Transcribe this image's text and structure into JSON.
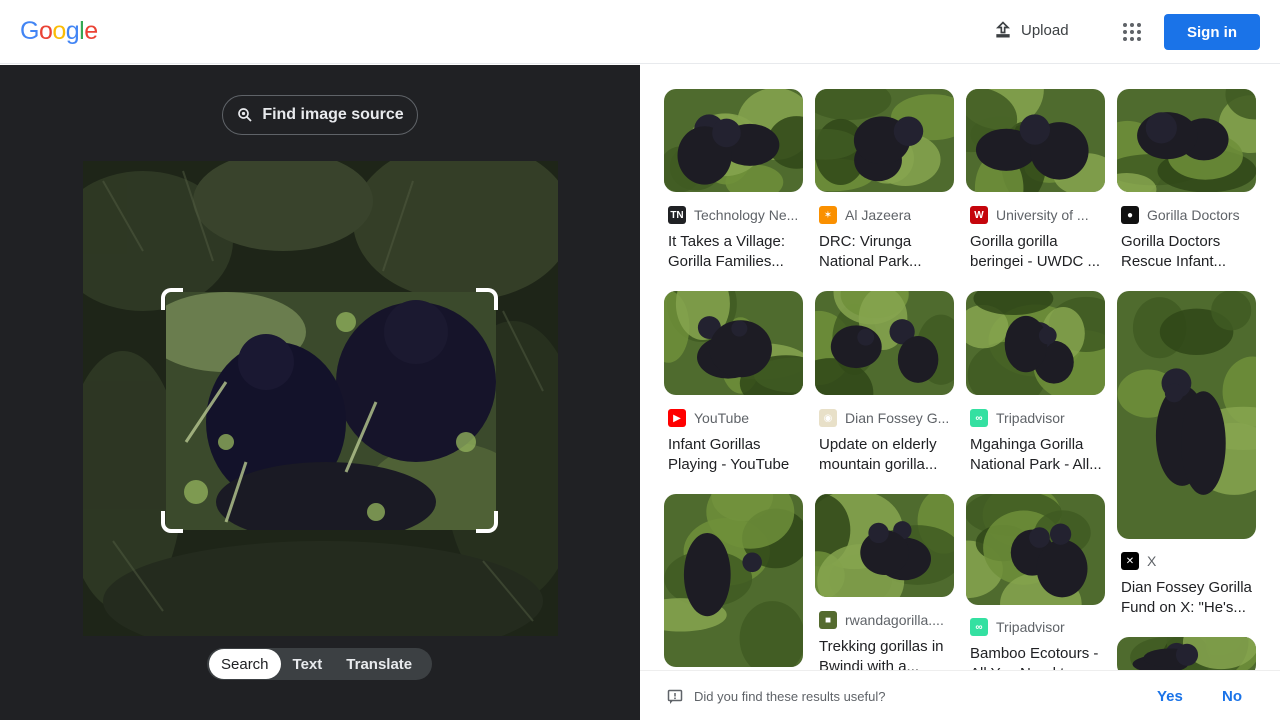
{
  "header": {
    "logo_letters": [
      {
        "ch": "G",
        "color": "#4285F4"
      },
      {
        "ch": "o",
        "color": "#EA4335"
      },
      {
        "ch": "o",
        "color": "#FBBC05"
      },
      {
        "ch": "g",
        "color": "#4285F4"
      },
      {
        "ch": "l",
        "color": "#34A853"
      },
      {
        "ch": "e",
        "color": "#EA4335"
      }
    ],
    "upload_label": "Upload",
    "signin_label": "Sign in"
  },
  "lens": {
    "find_source_label": "Find image source",
    "modes": [
      "Search",
      "Text",
      "Translate"
    ],
    "active_mode": "Search"
  },
  "results": [
    {
      "source": "Technology Ne...",
      "fav_color": "#202124",
      "fav_text": "TN",
      "title": [
        "It Takes a Village:",
        "Gorilla Families..."
      ]
    },
    {
      "source": "Al Jazeera",
      "fav_color": "#fa9000",
      "fav_text": "✶",
      "title": [
        "DRC: Virunga",
        "National Park..."
      ]
    },
    {
      "source": "University of ...",
      "fav_color": "#c5050c",
      "fav_text": "W",
      "title": [
        "Gorilla gorilla",
        "beringei - UWDC ..."
      ]
    },
    {
      "source": "Gorilla Doctors",
      "fav_color": "#111111",
      "fav_text": "●",
      "title": [
        "Gorilla Doctors",
        "Rescue Infant..."
      ]
    },
    {
      "source": "YouTube",
      "fav_color": "#ff0000",
      "fav_text": "▶",
      "title": [
        "Infant Gorillas",
        "Playing - YouTube"
      ]
    },
    {
      "source": "Dian Fossey G...",
      "fav_color": "#e8e0c8",
      "fav_text": "◉",
      "title": [
        "Update on elderly",
        "mountain gorilla..."
      ]
    },
    {
      "source": "Tripadvisor",
      "fav_color": "#34e0a1",
      "fav_text": "∞",
      "title": [
        "Mgahinga Gorilla",
        "National Park - All..."
      ]
    },
    {
      "source": "X",
      "fav_color": "#000000",
      "fav_text": "✕",
      "title": [
        "Dian Fossey Gorilla",
        "Fund on X: \"He's..."
      ]
    },
    {
      "source": "",
      "fav_color": "",
      "fav_text": "",
      "title": []
    },
    {
      "source": "rwandagorilla....",
      "fav_color": "#556b2f",
      "fav_text": "■",
      "title": [
        "Trekking gorillas in",
        "Bwindi with a..."
      ]
    },
    {
      "source": "Tripadvisor",
      "fav_color": "#34e0a1",
      "fav_text": "∞",
      "title": [
        "Bamboo Ecotours -",
        "All You Need to..."
      ]
    },
    {
      "source": "",
      "fav_color": "",
      "fav_text": "",
      "title": []
    }
  ],
  "feedback": {
    "question": "Did you find these results useful?",
    "yes_label": "Yes",
    "no_label": "No"
  }
}
